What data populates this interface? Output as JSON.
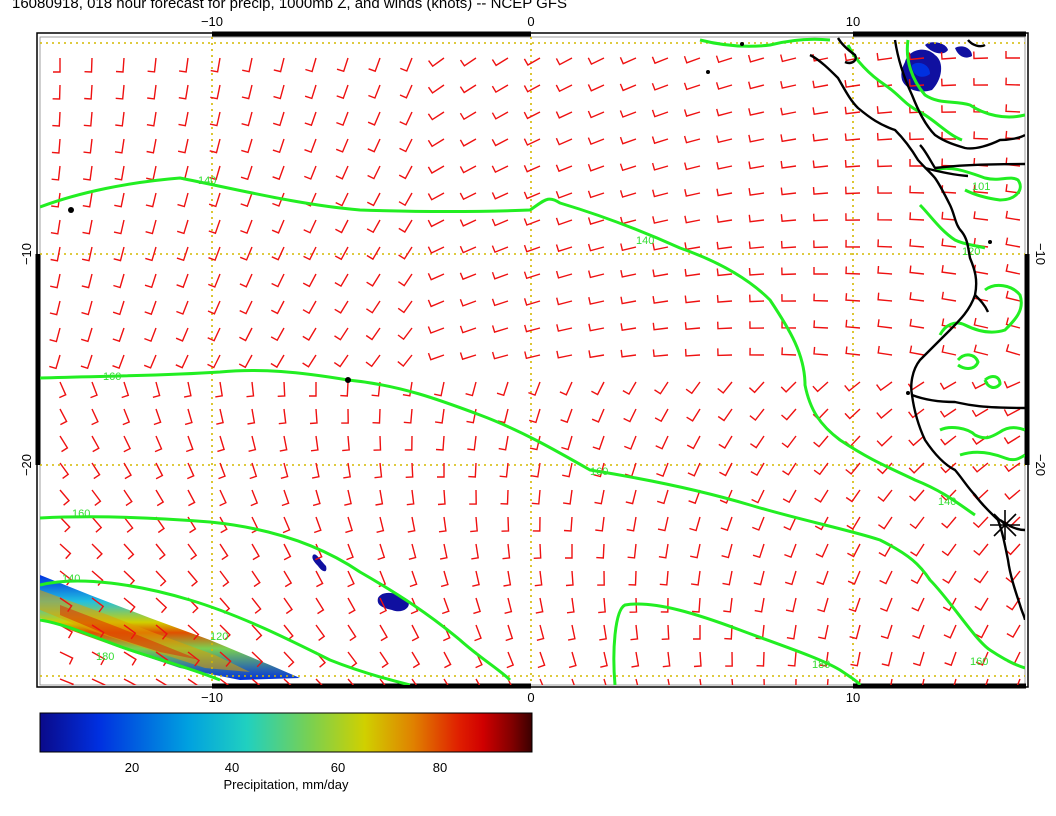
{
  "title": "16080918, 018 hour forecast for precip, 1000mb Z, and winds (knots) -- NCEP GFS",
  "map": {
    "lon_range": [
      -15,
      16
    ],
    "lat_range": [
      -28,
      2
    ],
    "grid_lines_lon": [
      -10,
      0,
      10
    ],
    "grid_lines_lat": [
      -10,
      -20
    ],
    "x_tick_labels": [
      "−10",
      "0",
      "10"
    ],
    "y_tick_labels": [
      "−10",
      "−20"
    ],
    "contour_color": "#22ee22",
    "barb_color": "#ee1111",
    "grid_color": "#d4b800",
    "coast_color": "#000000",
    "contour_labels": [
      "140",
      "160",
      "160",
      "140",
      "160",
      "120",
      "180",
      "140",
      "160",
      "180",
      "140",
      "120",
      "101",
      "140"
    ]
  },
  "colorbar": {
    "ticks": [
      "20",
      "40",
      "60",
      "80"
    ],
    "range": [
      2,
      96
    ],
    "label": "Precipitation, mm/day",
    "colors": [
      "#0a0a8a",
      "#0030e0",
      "#00a0e0",
      "#20d0c0",
      "#7ad050",
      "#d0d000",
      "#e08000",
      "#e02000",
      "#d00000",
      "#800000",
      "#3a0000"
    ]
  }
}
